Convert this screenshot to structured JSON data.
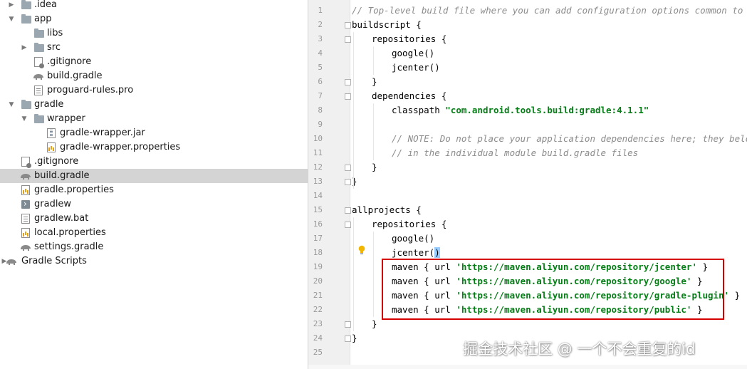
{
  "project_tree": {
    "items": [
      {
        "label": ".idea",
        "icon": "folder-icon",
        "depth": 1,
        "arrow": "collapsed"
      },
      {
        "label": "app",
        "icon": "folder-icon",
        "depth": 1,
        "arrow": "expanded"
      },
      {
        "label": "libs",
        "icon": "folder-icon",
        "depth": 2,
        "arrow": "none"
      },
      {
        "label": "src",
        "icon": "folder-icon",
        "depth": 2,
        "arrow": "collapsed"
      },
      {
        "label": ".gitignore",
        "icon": "gitignore-file-icon",
        "depth": 2,
        "arrow": "none"
      },
      {
        "label": "build.gradle",
        "icon": "gradle-elephant-icon",
        "depth": 2,
        "arrow": "none"
      },
      {
        "label": "proguard-rules.pro",
        "icon": "text-file-icon",
        "depth": 2,
        "arrow": "none"
      },
      {
        "label": "gradle",
        "icon": "folder-icon",
        "depth": 1,
        "arrow": "expanded"
      },
      {
        "label": "wrapper",
        "icon": "folder-icon",
        "depth": 2,
        "arrow": "expanded"
      },
      {
        "label": "gradle-wrapper.jar",
        "icon": "jar-file-icon",
        "depth": 3,
        "arrow": "none"
      },
      {
        "label": "gradle-wrapper.properties",
        "icon": "properties-file-icon",
        "depth": 3,
        "arrow": "none"
      },
      {
        "label": ".gitignore",
        "icon": "gitignore-file-icon",
        "depth": 1,
        "arrow": "none"
      },
      {
        "label": "build.gradle",
        "icon": "gradle-elephant-icon",
        "depth": 1,
        "arrow": "none",
        "selected": true
      },
      {
        "label": "gradle.properties",
        "icon": "properties-file-icon",
        "depth": 1,
        "arrow": "none"
      },
      {
        "label": "gradlew",
        "icon": "terminal-file-icon",
        "depth": 1,
        "arrow": "none"
      },
      {
        "label": "gradlew.bat",
        "icon": "text-file-icon",
        "depth": 1,
        "arrow": "none"
      },
      {
        "label": "local.properties",
        "icon": "properties-file-icon",
        "depth": 1,
        "arrow": "none"
      },
      {
        "label": "settings.gradle",
        "icon": "gradle-elephant-icon",
        "depth": 1,
        "arrow": "none"
      },
      {
        "label": "Gradle Scripts",
        "icon": "gradle-elephant-icon",
        "depth": 0,
        "arrow": "collapsed"
      }
    ]
  },
  "editor": {
    "lines": [
      {
        "n": "1",
        "indent": 0,
        "tokens": [
          {
            "t": "// Top-level build file where you can add configuration options common to all sub-projects/modules.",
            "c": "comment"
          }
        ]
      },
      {
        "n": "2",
        "indent": 0,
        "fold": true,
        "tokens": [
          {
            "t": "buildscript {",
            "c": "plain"
          }
        ]
      },
      {
        "n": "3",
        "indent": 1,
        "fold": true,
        "tokens": [
          {
            "t": "repositories {",
            "c": "plain"
          }
        ]
      },
      {
        "n": "4",
        "indent": 2,
        "tokens": [
          {
            "t": "google()",
            "c": "plain"
          }
        ]
      },
      {
        "n": "5",
        "indent": 2,
        "tokens": [
          {
            "t": "jcenter()",
            "c": "plain"
          }
        ]
      },
      {
        "n": "6",
        "indent": 1,
        "fold": true,
        "tokens": [
          {
            "t": "}",
            "c": "plain"
          }
        ]
      },
      {
        "n": "7",
        "indent": 1,
        "fold": true,
        "tokens": [
          {
            "t": "dependencies {",
            "c": "plain"
          }
        ]
      },
      {
        "n": "8",
        "indent": 2,
        "tokens": [
          {
            "t": "classpath ",
            "c": "plain"
          },
          {
            "t": "\"com.android.tools.build:gradle:4.1.1\"",
            "c": "string"
          }
        ]
      },
      {
        "n": "9",
        "indent": 2,
        "tokens": []
      },
      {
        "n": "10",
        "indent": 2,
        "tokens": [
          {
            "t": "// NOTE: Do not place your application dependencies here; they belong",
            "c": "comment"
          }
        ]
      },
      {
        "n": "11",
        "indent": 2,
        "tokens": [
          {
            "t": "// in the individual module build.gradle files",
            "c": "comment"
          }
        ]
      },
      {
        "n": "12",
        "indent": 1,
        "fold": true,
        "tokens": [
          {
            "t": "}",
            "c": "plain"
          }
        ]
      },
      {
        "n": "13",
        "indent": 0,
        "fold": true,
        "tokens": [
          {
            "t": "}",
            "c": "plain"
          }
        ]
      },
      {
        "n": "14",
        "indent": 0,
        "tokens": []
      },
      {
        "n": "15",
        "indent": 0,
        "fold": true,
        "tokens": [
          {
            "t": "allprojects {",
            "c": "plain"
          }
        ]
      },
      {
        "n": "16",
        "indent": 1,
        "fold": true,
        "tokens": [
          {
            "t": "repositories {",
            "c": "plain"
          }
        ]
      },
      {
        "n": "17",
        "indent": 2,
        "tokens": [
          {
            "t": "google()",
            "c": "plain"
          }
        ]
      },
      {
        "n": "18",
        "indent": 2,
        "tokens": [
          {
            "t": "jcenter(",
            "c": "plain"
          },
          {
            "t": ")",
            "c": "bracket-hl"
          }
        ]
      },
      {
        "n": "19",
        "indent": 2,
        "tokens": [
          {
            "t": "maven { url ",
            "c": "plain"
          },
          {
            "t": "'https://maven.aliyun.com/repository/jcenter'",
            "c": "string"
          },
          {
            "t": " }",
            "c": "plain"
          }
        ]
      },
      {
        "n": "20",
        "indent": 2,
        "tokens": [
          {
            "t": "maven { url ",
            "c": "plain"
          },
          {
            "t": "'https://maven.aliyun.com/repository/google'",
            "c": "string"
          },
          {
            "t": " }",
            "c": "plain"
          }
        ]
      },
      {
        "n": "21",
        "indent": 2,
        "tokens": [
          {
            "t": "maven { url ",
            "c": "plain"
          },
          {
            "t": "'https://maven.aliyun.com/repository/gradle-plugin'",
            "c": "string"
          },
          {
            "t": " }",
            "c": "plain"
          }
        ]
      },
      {
        "n": "22",
        "indent": 2,
        "tokens": [
          {
            "t": "maven { url ",
            "c": "plain"
          },
          {
            "t": "'https://maven.aliyun.com/repository/public'",
            "c": "string"
          },
          {
            "t": " }",
            "c": "plain"
          }
        ]
      },
      {
        "n": "23",
        "indent": 1,
        "fold": true,
        "tokens": [
          {
            "t": "}",
            "c": "plain"
          }
        ]
      },
      {
        "n": "24",
        "indent": 0,
        "fold": true,
        "tokens": [
          {
            "t": "}",
            "c": "plain"
          }
        ]
      },
      {
        "n": "25",
        "indent": 0,
        "tokens": []
      }
    ],
    "intention_bulb_icon": "lightbulb-icon"
  },
  "watermark": "掘金技术社区 @ 一个不会重复的id",
  "colors": {
    "comment": "#8c8c8c",
    "string": "#067d17",
    "selection": "#d4d4d4",
    "highlight_box": "#d40000",
    "bulb": "#f2b600"
  }
}
